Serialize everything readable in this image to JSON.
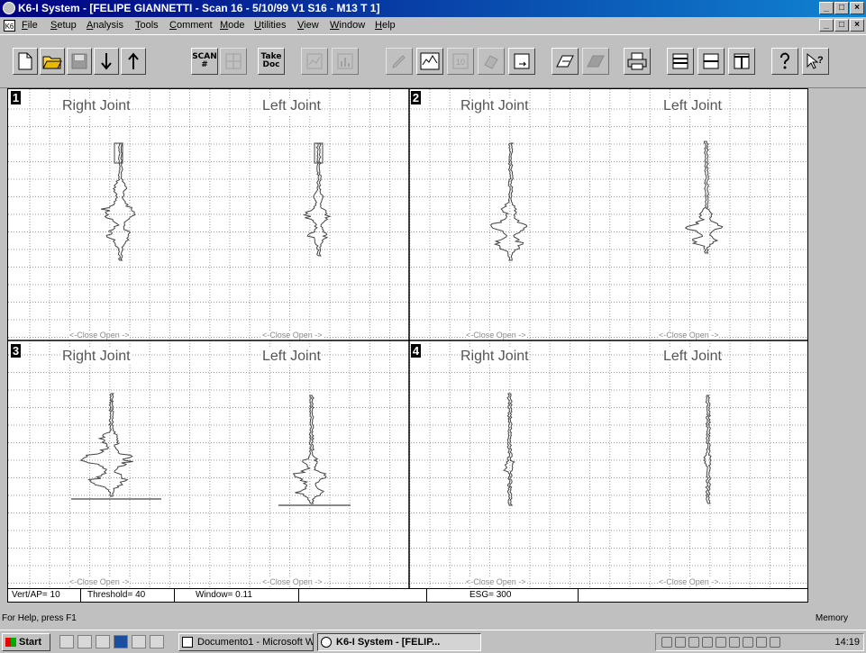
{
  "window": {
    "title": "K6-I System - [FELIPE GIANNETTI - Scan 16 - 5/10/99  V1 S16 - M13 T 1]",
    "controls": [
      "_",
      "□",
      "×"
    ]
  },
  "menu": {
    "items": [
      "File",
      "Setup",
      "Analysis",
      "Tools",
      "Comment",
      "Mode",
      "Utilities",
      "View",
      "Window",
      "Help"
    ]
  },
  "toolbar": {
    "scan_label_1": "SCAN",
    "scan_label_2": "#",
    "take_label_1": "Take",
    "take_label_2": "Doc"
  },
  "panels": [
    {
      "number": "1",
      "right_title": "Right Joint",
      "left_title": "Left Joint",
      "right_axis": "<-Close   Open ->",
      "left_axis": "<-Close   Open ->"
    },
    {
      "number": "2",
      "right_title": "Right Joint",
      "left_title": "Left Joint",
      "right_axis": "<-Close   Open ->",
      "left_axis": "<-Close   Open ->"
    },
    {
      "number": "3",
      "right_title": "Right Joint",
      "left_title": "Left Joint",
      "right_axis": "<-Close   Open ->",
      "left_axis": "<-Close   Open ->"
    },
    {
      "number": "4",
      "right_title": "Right Joint",
      "left_title": "Left Joint",
      "right_axis": "<-Close   Open ->",
      "left_axis": "<-Close   Open ->"
    }
  ],
  "plot_status": {
    "vert_ap": "Vert/AP= 10",
    "threshold": "Threshold= 40",
    "window": "Window= 0.11",
    "esg": "ESG= 300"
  },
  "status_bar": {
    "help": "For Help, press F1",
    "memory": "Memory"
  },
  "taskbar": {
    "start": "Start",
    "tasks": [
      "Documento1 - Microsoft W...",
      "K6-I System - [FELIP..."
    ],
    "clock": "14:19"
  },
  "colors": {
    "title_gradient_start": "#000080",
    "title_gradient_end": "#1084d0",
    "window_face": "#c0c0c0",
    "plot_background": "#ffffff",
    "grid": "#9a9a9a"
  }
}
